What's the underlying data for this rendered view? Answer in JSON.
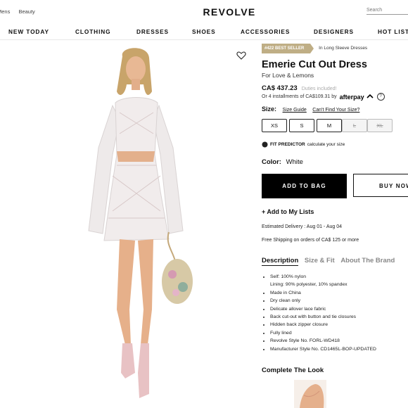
{
  "header": {
    "top_links": [
      "Mens",
      "Beauty"
    ],
    "logo": "REVOLVE",
    "search_placeholder": "Search"
  },
  "nav": {
    "items": [
      "NEW TODAY",
      "CLOTHING",
      "DRESSES",
      "SHOES",
      "ACCESSORIES",
      "DESIGNERS",
      "HOT LIST"
    ]
  },
  "product": {
    "badge": "#422 BEST SELLER",
    "category": "In Long Sleeve Dresses",
    "title": "Emerie Cut Out Dress",
    "brand": "For Love & Lemons",
    "price": "CA$ 437.23",
    "duties": "Duties included!",
    "installments": "Or 4 installments of CA$109.31 by",
    "afterpay": "afterpay",
    "size_label": "Size:",
    "size_guide": "Size Guide",
    "cant_find_size": "Can't Find Your Size?",
    "sizes": [
      {
        "label": "XS",
        "available": true
      },
      {
        "label": "S",
        "available": true
      },
      {
        "label": "M",
        "available": true
      },
      {
        "label": "L",
        "available": false
      },
      {
        "label": "XL",
        "available": false
      }
    ],
    "fit_predictor": "FIT PREDICTOR",
    "fit_predictor_text": "calculate your size",
    "color_label": "Color:",
    "color_value": "White",
    "add_to_bag": "ADD TO BAG",
    "buy_now": "BUY NOW",
    "add_to_list": "+ Add to My Lists",
    "delivery": "Estimated Delivery : Aug 01 - Aug 04",
    "shipping": "Free Shipping on orders of CA$ 125 or more"
  },
  "tabs": [
    "Description",
    "Size & Fit",
    "About The Brand"
  ],
  "details": [
    "Self: 100% nylon",
    "Lining: 90% polyester, 10% spandex",
    "Made in China",
    "Dry clean only",
    "Delicate allover lace fabric",
    "Back cut-out with button and tie closures",
    "Hidden back zipper closure",
    "Fully lined",
    "Revolve Style No. FORL-WD418",
    "Manufacturer Style No. CD1465L-BOP-UPDATED"
  ],
  "complete_the_look": "Complete The Look",
  "colors": {
    "badge": "#bfae85",
    "primary": "#000000"
  },
  "icons": [
    "heart-icon",
    "question-icon",
    "fit-predictor-icon",
    "search-icon"
  ]
}
